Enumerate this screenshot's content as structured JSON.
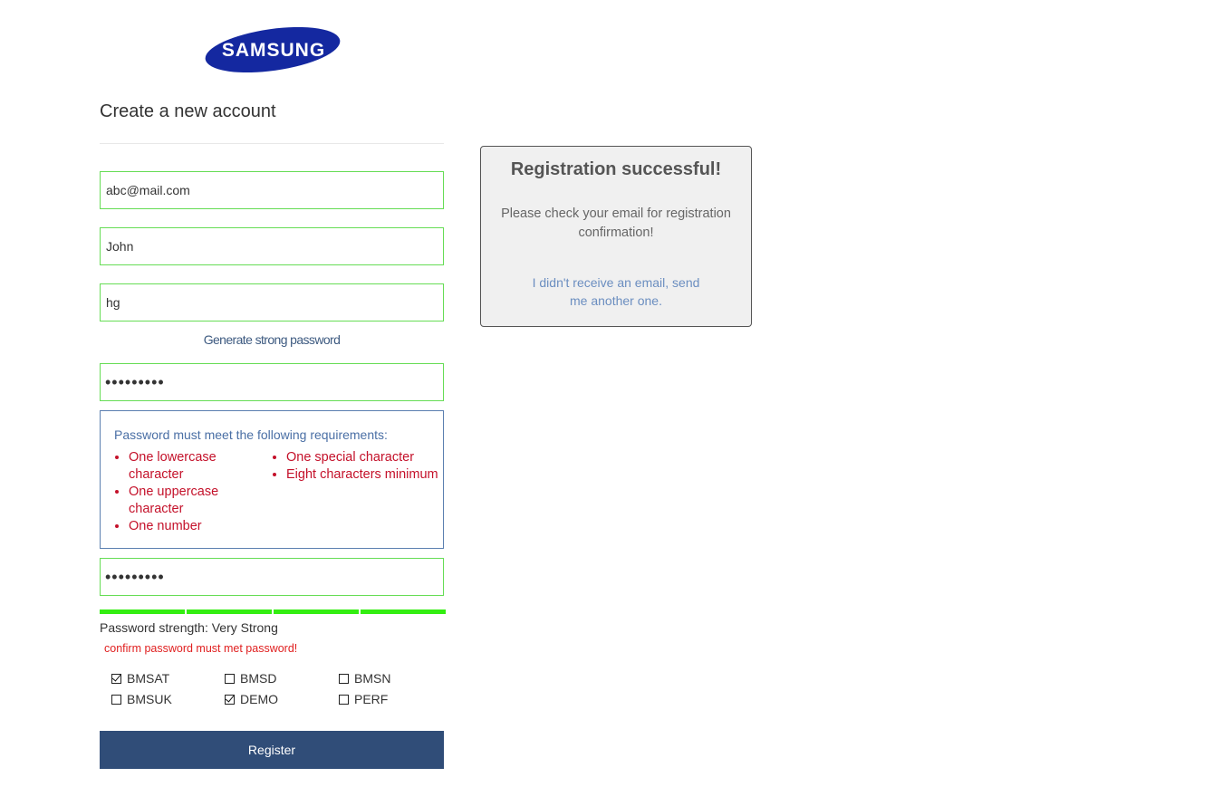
{
  "logo": {
    "text": "SAMSUNG",
    "color": "#1428a0"
  },
  "form": {
    "title": "Create a new account",
    "email_value": "abc@mail.com",
    "first_name_value": "John",
    "last_name_value": "hg",
    "generate_password_link": "Generate strong password",
    "password_value": "hunter123",
    "confirm_password_value": "hunter123",
    "requirements": {
      "heading": "Password must meet the following requirements:",
      "items_col1": [
        "One lowercase character",
        "One uppercase character",
        "One number"
      ],
      "items_col2": [
        "One special character",
        "Eight characters minimum"
      ]
    },
    "strength_label": "Password strength: Very Strong",
    "strength_level": 1.0,
    "strength_color": "#33ee11",
    "error_message": "confirm password must met password!",
    "checkboxes": [
      {
        "label": "BMSAT",
        "checked": true
      },
      {
        "label": "BMSD",
        "checked": false
      },
      {
        "label": "BMSN",
        "checked": false
      },
      {
        "label": "BMSUK",
        "checked": false
      },
      {
        "label": "DEMO",
        "checked": true
      },
      {
        "label": "PERF",
        "checked": false
      }
    ],
    "register_label": "Register",
    "register_color": "#304d78"
  },
  "success": {
    "title": "Registration successful!",
    "message": "Please check your email for registration confirmation!",
    "resend_link": "I didn't receive an email, send me another one."
  }
}
